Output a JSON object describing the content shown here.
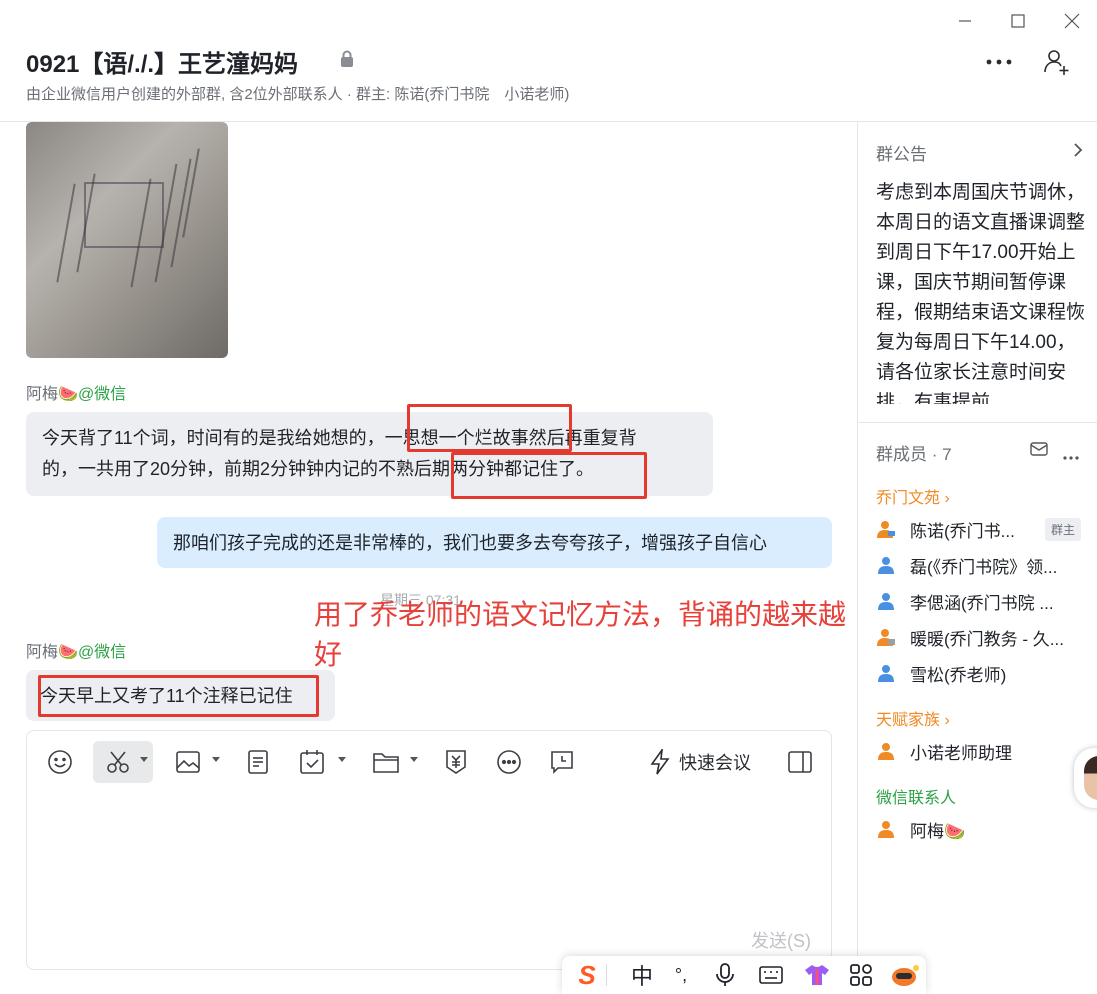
{
  "window": {
    "title": "0921【语/./.】王艺潼妈妈",
    "subtitle": "由企业微信用户创建的外部群, 含2位外部联系人 · 群主: 陈诺(乔门书院　小诺老师)"
  },
  "chat": {
    "messages": [
      {
        "sender_name": "阿梅🍉",
        "sender_tag": "@微信",
        "text_line1": "今天背了11个词，时间有的是我给她想的，一思想一个烂故事然后再重复背",
        "text_line2": "的，一共用了20分钟，前期2分钟钟内记的不熟后期两分钟都记住了。"
      },
      {
        "text": "那咱们孩子完成的还是非常棒的，我们也要多去夸夸孩子，增强孩子自信心"
      },
      {
        "timestamp": "星期三 07:31"
      },
      {
        "sender_name": "阿梅🍉",
        "sender_tag": "@微信",
        "text": "今天早上又考了11个注释已记住"
      }
    ],
    "overlay_annotation": "用了乔老师的语文记忆方法，背诵的越来越好"
  },
  "composer": {
    "quick_meeting_label": "快速会议",
    "send_label": "发送(S)"
  },
  "side": {
    "notice_title": "群公告",
    "notice_body": "考虑到本周国庆节调休，本周日的语文直播课调整到周日下午17.00开始上课，国庆节期间暂停课程，假期结束语文课程恢复为每周日下午14.00，请各位家长注意时间安排，有事提前",
    "members_title": "群成员 · 7",
    "groups": [
      {
        "label": "乔门文苑",
        "members": [
          "陈诺(乔门书...",
          "磊(《乔门书院》领...",
          "李偲涵(乔门书院 ...",
          "暖暖(乔门教务 - 久...",
          "雪松(乔老师)"
        ]
      },
      {
        "label": "天赋家族",
        "members": [
          "小诺老师助理"
        ]
      },
      {
        "label": "微信联系人",
        "members": [
          "阿梅🍉"
        ]
      }
    ],
    "owner_badge": "群主"
  },
  "ime": {
    "logo": "S",
    "lang": "中",
    "punct": "°,"
  }
}
